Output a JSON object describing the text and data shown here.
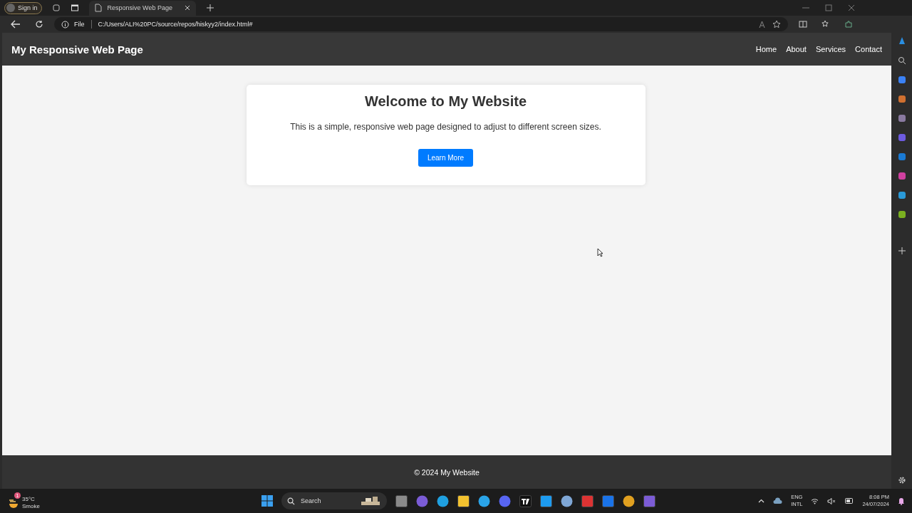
{
  "browser": {
    "profile_button": "Sign in",
    "tab": {
      "title": "Responsive Web Page"
    },
    "address": {
      "scheme": "File",
      "url": "C:/Users/ALI%20PC/source/repos/hiskyy2/index.html#"
    }
  },
  "page": {
    "brand": "My Responsive Web Page",
    "nav": [
      "Home",
      "About",
      "Services",
      "Contact"
    ],
    "card": {
      "title": "Welcome to My Website",
      "text": "This is a simple, responsive web page designed to adjust to different screen sizes.",
      "button": "Learn More"
    },
    "footer": "© 2024 My Website"
  },
  "taskbar": {
    "weather": {
      "badge": "1",
      "temperature": "35°C",
      "condition": "Smoke"
    },
    "search": "Search",
    "language": [
      "ENG",
      "INTL"
    ],
    "time": "8:08 PM",
    "date": "24/07/2024"
  }
}
